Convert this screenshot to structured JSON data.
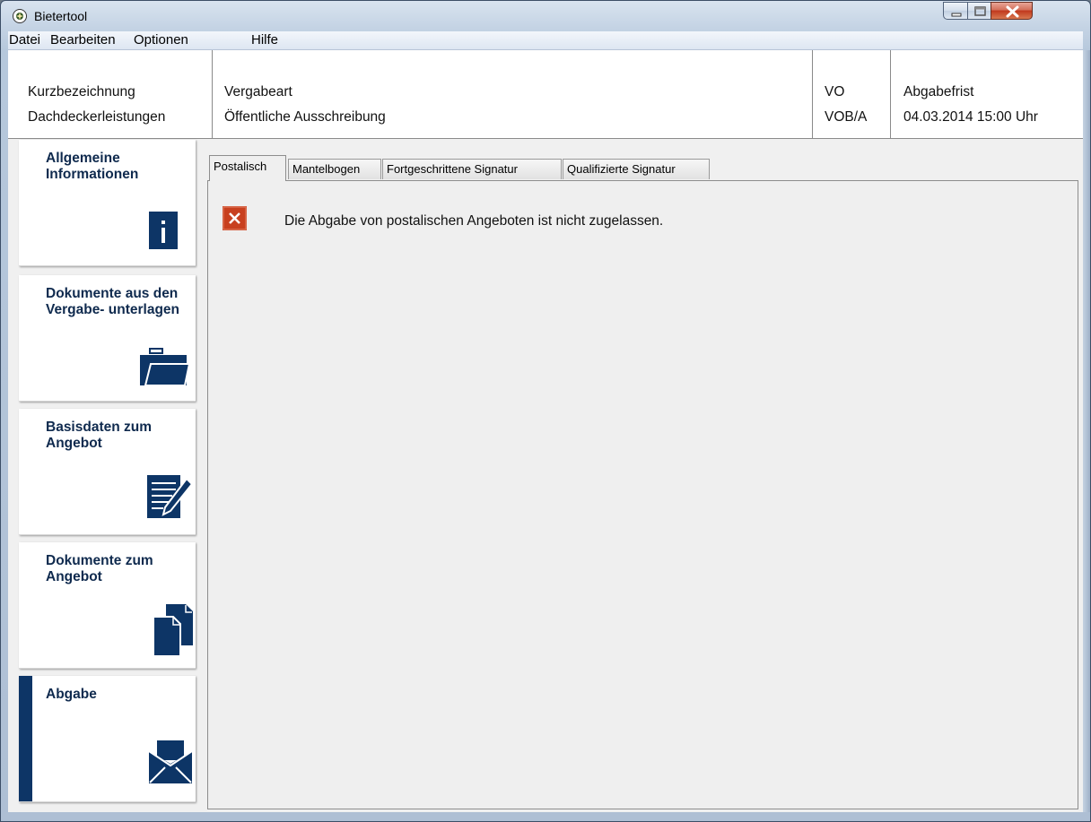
{
  "window": {
    "title": "Bietertool",
    "min_icon": "minimize-icon",
    "max_icon": "maximize-icon",
    "close_icon": "close-icon"
  },
  "menu": {
    "items": [
      "Datei",
      "Bearbeiten",
      "Optionen",
      "Hilfe"
    ]
  },
  "info": {
    "kurz_label": "Kurzbezeichnung",
    "kurz_value": "Dachdeckerleistungen",
    "vergabeart_label": "Vergabeart",
    "vergabeart_value": "Öffentliche Ausschreibung",
    "vo_label": "VO",
    "vo_value": "VOB/A",
    "frist_label": "Abgabefrist",
    "frist_value": "04.03.2014 15:00 Uhr"
  },
  "sidebar": {
    "items": [
      {
        "label": "Allgemeine Informationen",
        "icon": "info-icon"
      },
      {
        "label": "Dokumente aus den Vergabe- unterlagen",
        "icon": "folder-icon"
      },
      {
        "label": "Basisdaten zum Angebot",
        "icon": "edit-icon"
      },
      {
        "label": "Dokumente zum Angebot",
        "icon": "documents-icon"
      },
      {
        "label": "Abgabe",
        "icon": "envelope-icon",
        "active": true
      }
    ]
  },
  "tabs": {
    "items": [
      "Postalisch",
      "Mantelbogen",
      "Fortgeschrittene Signatur",
      "Qualifizierte Signatur"
    ],
    "active": "Postalisch"
  },
  "message": {
    "icon": "error-icon",
    "text": "Die Abgabe von postalischen Angeboten ist nicht zugelassen."
  },
  "colors": {
    "navy": "#0d3566",
    "error_red": "#c8401f"
  }
}
